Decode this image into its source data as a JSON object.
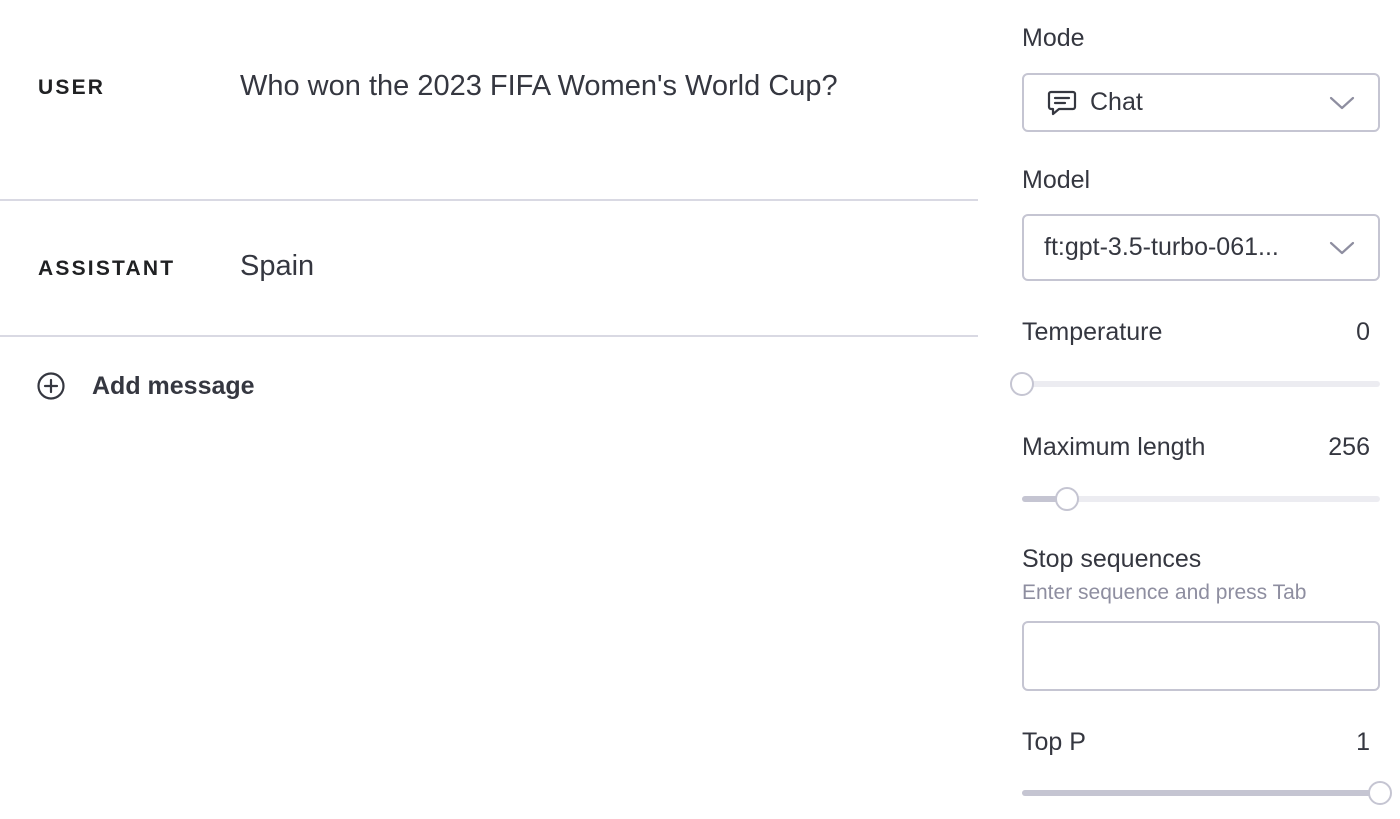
{
  "messages": [
    {
      "role": "USER",
      "text": "Who won the 2023 FIFA Women's World Cup?"
    },
    {
      "role": "ASSISTANT",
      "text": "Spain"
    }
  ],
  "add_message": {
    "label": "Add message",
    "icon": "plus-circle-icon"
  },
  "settings": {
    "mode": {
      "label": "Mode",
      "value": "Chat",
      "icon": "chat-bubble-icon"
    },
    "model": {
      "label": "Model",
      "value": "ft:gpt-3.5-turbo-061..."
    },
    "temperature": {
      "label": "Temperature",
      "value": "0",
      "level": 0.0
    },
    "maximum_length": {
      "label": "Maximum length",
      "value": "256",
      "level": 0.125
    },
    "stop_sequences": {
      "label": "Stop sequences",
      "hint": "Enter sequence and press Tab",
      "value": ""
    },
    "top_p": {
      "label": "Top P",
      "value": "1",
      "level": 1.0
    }
  },
  "colors": {
    "border": "#c5c5d2",
    "divider": "#d9d9e3",
    "track": "#ececf1",
    "text": "#353740",
    "hint": "#8e8ea0"
  }
}
